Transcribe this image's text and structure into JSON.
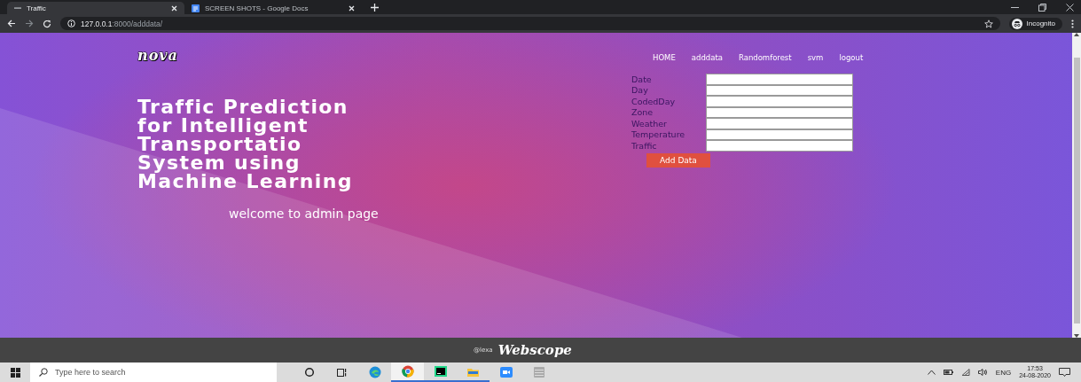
{
  "browser": {
    "tabs": [
      {
        "title": "Traffic",
        "selected": true
      },
      {
        "title": "SCREEN SHOTS - Google Docs",
        "selected": false
      }
    ],
    "url_host": "127.0.0.1",
    "url_path": ":8000/adddata/",
    "profile": "Incognito"
  },
  "site": {
    "logo": "nova",
    "nav": [
      {
        "label": "HOME"
      },
      {
        "label": "adddata"
      },
      {
        "label": "Randomforest"
      },
      {
        "label": "svm"
      },
      {
        "label": "logout"
      }
    ],
    "heading": "Traffic Prediction\nfor Intelligent\nTransportatio\nSystem using\nMachine Learning",
    "welcome": "welcome to admin page",
    "form": {
      "fields": [
        {
          "label": "Date"
        },
        {
          "label": "Day"
        },
        {
          "label": "CodedDay"
        },
        {
          "label": "Zone"
        },
        {
          "label": "Weather"
        },
        {
          "label": "Temperature"
        },
        {
          "label": "Traffic"
        }
      ],
      "submit": "Add Data"
    }
  },
  "footer": {
    "credit": "@lexa",
    "brand": "Webscope"
  },
  "taskbar": {
    "search_placeholder": "Type here to search",
    "language": "ENG",
    "time": "17:53",
    "date": "24-08-2020"
  }
}
